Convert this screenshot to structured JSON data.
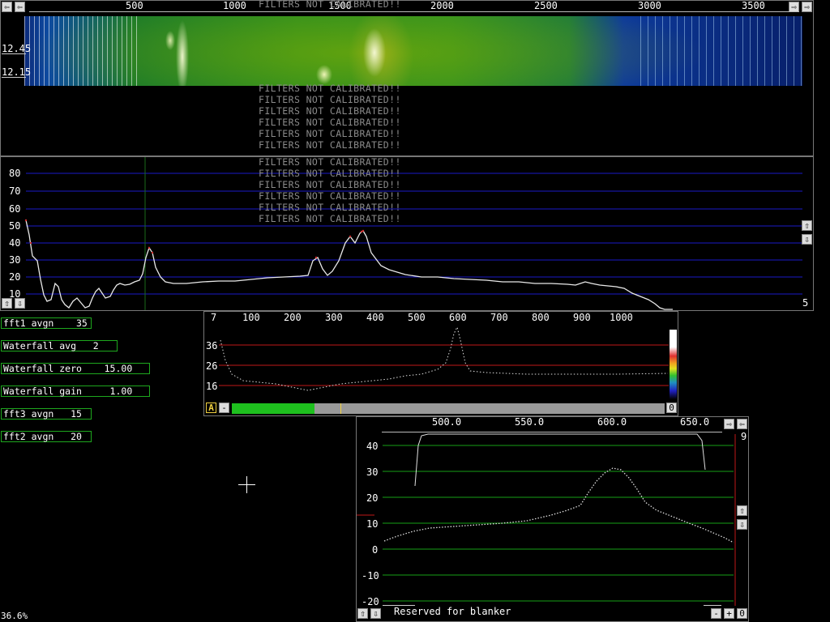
{
  "top_axis": {
    "ticks": [
      "500",
      "1000",
      "1500",
      "2000",
      "2500",
      "3000",
      "3500"
    ]
  },
  "waterfall": {
    "time_labels": [
      "12.45",
      "12.15"
    ]
  },
  "calibration_warning": "FILTERS NOT CALIBRATED!!",
  "spectrum": {
    "y_ticks": [
      "80",
      "70",
      "60",
      "50",
      "40",
      "30",
      "20",
      "10"
    ],
    "corner_value": "5"
  },
  "params": [
    {
      "label": "fft1 avgn    35"
    },
    {
      "label": "Waterfall avg   2"
    },
    {
      "label": "Waterfall zero    15.00"
    },
    {
      "label": "Waterfall gain     1.00"
    },
    {
      "label": "fft3 avgn   15"
    },
    {
      "label": "fft2 avgn   20"
    }
  ],
  "mid_panel": {
    "x_ticks": [
      "7",
      "100",
      "200",
      "300",
      "400",
      "500",
      "600",
      "700",
      "800",
      "900",
      "1000"
    ],
    "y_ticks": [
      "36",
      "26",
      "16"
    ],
    "a_button": "A",
    "minus_button": "-",
    "zero_button": "0"
  },
  "baseband": {
    "x_ticks": [
      "500.0",
      "550.0",
      "600.0",
      "650.0"
    ],
    "y_ticks": [
      "40",
      "30",
      "20",
      "10",
      "0",
      "-10",
      "-20"
    ],
    "corner_value": "9",
    "status_text": "Reserved for blanker",
    "minus_button": "-",
    "plus_button": "+",
    "zero_button": "0"
  },
  "cpu_load": "36.6%",
  "icons": {
    "left": "⇦",
    "right": "⇨",
    "up": "⇧",
    "down": "⇩"
  },
  "colors": {
    "grid_blue": "#1a1ac8",
    "grid_red": "#c01818",
    "grid_green": "#16a016",
    "param_border": "#1ea81e"
  }
}
